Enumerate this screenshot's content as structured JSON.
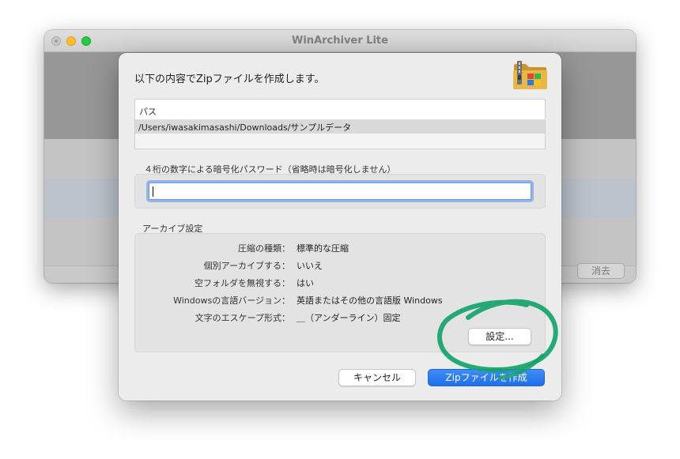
{
  "main_window": {
    "title": "WinArchiver Lite",
    "erase_label": "消去"
  },
  "dialog": {
    "heading": "以下の内容でZipファイルを作成します。",
    "path_table": {
      "column_header": "パス",
      "rows": [
        "/Users/iwasakimasashi/Downloads/サンプルデータ"
      ]
    },
    "password_label": "４桁の数字による暗号化パスワード（省略時は暗号化しません）",
    "password_value": "",
    "archive_settings_label": "アーカイブ設定",
    "settings": [
      {
        "key": "圧縮の種類：",
        "value": "標準的な圧縮"
      },
      {
        "key": "個別アーカイブする：",
        "value": "いいえ"
      },
      {
        "key": "空フォルダを無視する：",
        "value": "はい"
      },
      {
        "key": "Windowsの言語バージョン：",
        "value": "英語またはその他の言語版 Windows"
      },
      {
        "key": "文字のエスケープ形式：",
        "value": "＿（アンダーライン）固定"
      }
    ],
    "settings_button": "設定...",
    "cancel_button": "キャンセル",
    "create_button": "Zipファイルを作成"
  },
  "colors": {
    "accent": "#1f6fea",
    "annotation": "#16a36a"
  },
  "icons": {
    "app": "archive-folder-icon"
  }
}
